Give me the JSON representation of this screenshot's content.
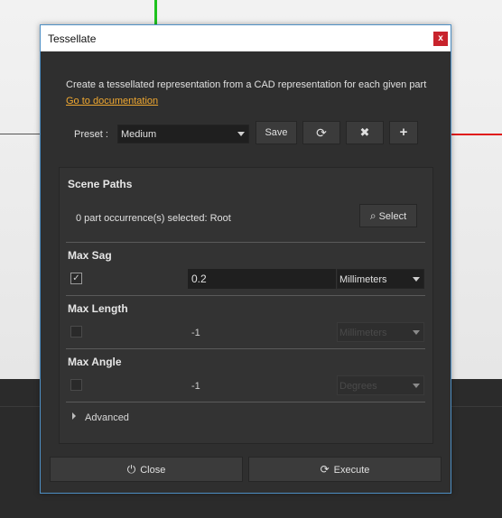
{
  "window": {
    "title": "Tessellate",
    "close_glyph": "x"
  },
  "description": "Create a tessellated representation from a CAD representation for each given part",
  "doc_link": "Go to documentation",
  "preset": {
    "label": "Preset :",
    "selected": "Medium",
    "save_label": "Save",
    "refresh_icon": "⟳",
    "delete_icon": "✖",
    "add_icon": "+"
  },
  "scene_paths": {
    "title": "Scene Paths",
    "status": "0 part occurrence(s) selected: Root",
    "select_label": "Select",
    "select_icon": "⌕"
  },
  "max_sag": {
    "title": "Max Sag",
    "checked": true,
    "check_glyph": "✓",
    "value": "0.2",
    "unit": "Millimeters"
  },
  "max_length": {
    "title": "Max Length",
    "checked": false,
    "value": "-1",
    "unit": "Millimeters"
  },
  "max_angle": {
    "title": "Max Angle",
    "checked": false,
    "value": "-1",
    "unit": "Degrees"
  },
  "advanced_label": "Advanced",
  "footer": {
    "close_label": "Close",
    "close_icon": "⏻",
    "execute_label": "Execute",
    "execute_icon": "⟳"
  },
  "colors": {
    "accent_link": "#f0a830",
    "close_button": "#c8232c",
    "axis_x": "#e01818",
    "axis_y": "#1ec21e"
  }
}
